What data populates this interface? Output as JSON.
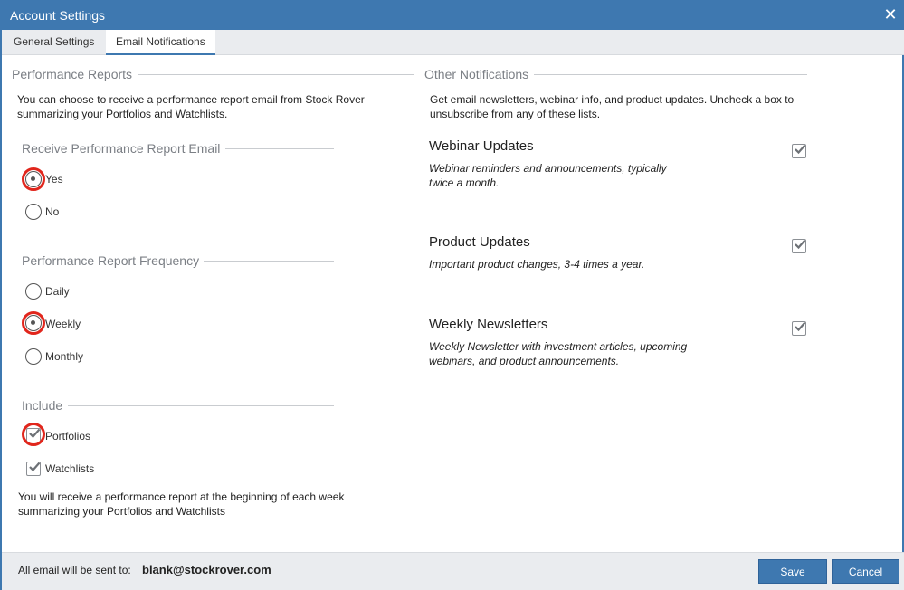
{
  "window": {
    "title": "Account Settings",
    "close_icon": "close-icon"
  },
  "tabs": [
    {
      "label": "General Settings",
      "active": false
    },
    {
      "label": "Email Notifications",
      "active": true
    }
  ],
  "performance": {
    "section_title": "Performance Reports",
    "description": "You can choose to receive a performance report email from Stock Rover summarizing your Portfolios and Watchlists.",
    "receive": {
      "title": "Receive Performance Report Email",
      "options": [
        "Yes",
        "No"
      ],
      "selected": "Yes"
    },
    "frequency": {
      "title": "Performance Report Frequency",
      "options": [
        "Daily",
        "Weekly",
        "Monthly"
      ],
      "selected": "Weekly"
    },
    "include": {
      "title": "Include",
      "items": [
        {
          "label": "Portfolios",
          "checked": true
        },
        {
          "label": "Watchlists",
          "checked": true
        }
      ]
    },
    "summary": "You will receive a performance report at the beginning of each week summarizing your Portfolios and Watchlists"
  },
  "other": {
    "section_title": "Other Notifications",
    "description": "Get email newsletters, webinar info, and product updates. Uncheck a box to unsubscribe from any of these lists.",
    "items": [
      {
        "title": "Webinar Updates",
        "description": "Webinar reminders and announcements, typically twice a month.",
        "checked": true
      },
      {
        "title": "Product Updates",
        "description": "Important product changes, 3-4 times a year.",
        "checked": true
      },
      {
        "title": "Weekly Newsletters",
        "description": "Weekly Newsletter with investment articles, upcoming webinars, and product announcements.",
        "checked": true
      }
    ]
  },
  "footer": {
    "label": "All email will be sent to:",
    "email": "blank@stockrover.com",
    "save_label": "Save",
    "cancel_label": "Cancel"
  },
  "colors": {
    "accent": "#3e78b0",
    "highlight": "#e1261c",
    "panel_bg": "#eaecef"
  }
}
